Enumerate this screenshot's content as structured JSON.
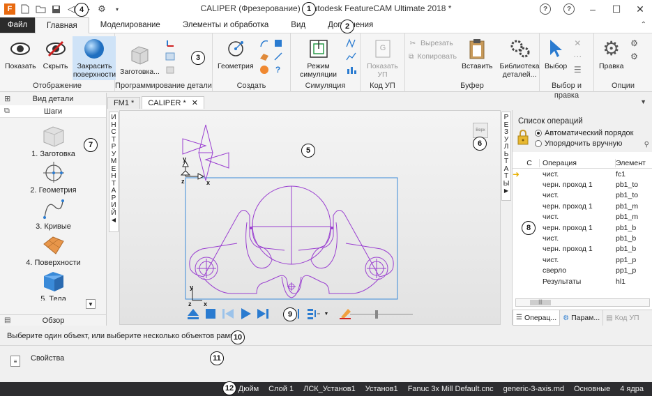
{
  "titlebar": {
    "title": "CALIPER (Фрезерование) - Autodesk FeatureCAM Ultimate 2018 *",
    "logo_text": "F"
  },
  "ribbon_tabs": [
    {
      "label": "Файл"
    },
    {
      "label": "Главная"
    },
    {
      "label": "Моделирование"
    },
    {
      "label": "Элементы и обработка"
    },
    {
      "label": "Вид"
    },
    {
      "label": "Дополнения"
    }
  ],
  "ribbon": {
    "groups": {
      "display": {
        "label": "Отображение",
        "show": "Показать",
        "hide": "Скрыть",
        "shade": "Закрасить поверхности"
      },
      "programming": {
        "label": "Программирование детали",
        "stock": "Заготовка..."
      },
      "create": {
        "label": "Создать",
        "geometry": "Геометрия"
      },
      "simulation": {
        "label": "Симуляция",
        "mode": "Режим симуляции"
      },
      "nc": {
        "label": "Код УП",
        "show_nc": "Показать УП",
        "nc_icon_letter": "G"
      },
      "clipboard": {
        "label": "Буфер",
        "cut": "Вырезать",
        "copy": "Копировать",
        "paste": "Вставить",
        "library": "Библиотека деталей..."
      },
      "select": {
        "label": "Выбор и правка",
        "select": "Выбор"
      },
      "options": {
        "label": "Опции",
        "edit": "Правка"
      }
    }
  },
  "left_panel": {
    "part_view": "Вид детали",
    "steps": "Шаги",
    "items": [
      {
        "label": "1.  Заготовка"
      },
      {
        "label": "2.  Геометрия"
      },
      {
        "label": "3.  Кривые"
      },
      {
        "label": "4.  Поверхности"
      },
      {
        "label": "5.  Тела"
      }
    ],
    "overview": "Обзор"
  },
  "doc_tabs": [
    {
      "label": "FM1 *"
    },
    {
      "label": "CALIPER *"
    }
  ],
  "side_tabs": {
    "tools": [
      "И",
      "Н",
      "С",
      "Т",
      "Р",
      "У",
      "М",
      "Е",
      "Н",
      "Т",
      "А",
      "Р",
      "И",
      "Й"
    ],
    "results": [
      "Р",
      "Е",
      "З",
      "У",
      "Л",
      "Ь",
      "Т",
      "А",
      "Т",
      "Ы"
    ]
  },
  "viewport": {
    "viewcube_label": "Верх",
    "axis_x": "x",
    "axis_y": "y",
    "axis_z": "z"
  },
  "right_panel": {
    "title": "Список операций",
    "auto_order": "Автоматический порядок",
    "manual_order": "Упорядочить вручную",
    "headers": {
      "c": "С",
      "operation": "Операция",
      "element": "Элемент"
    },
    "rows": [
      {
        "op": "чист.",
        "el": "fc1"
      },
      {
        "op": "черн. проход 1",
        "el": "pb1_to"
      },
      {
        "op": "чист.",
        "el": "pb1_to"
      },
      {
        "op": "черн. проход 1",
        "el": "pb1_m"
      },
      {
        "op": "чист.",
        "el": "pb1_m"
      },
      {
        "op": "черн. проход 1",
        "el": "pb1_b"
      },
      {
        "op": "чист.",
        "el": "pb1_b"
      },
      {
        "op": "черн. проход 1",
        "el": "pb1_b"
      },
      {
        "op": "чист.",
        "el": "pp1_p"
      },
      {
        "op": "сверло",
        "el": "pp1_p"
      },
      {
        "op": "Результаты",
        "el": "hl1"
      }
    ],
    "tabs": [
      {
        "label": "Операц..."
      },
      {
        "label": "Парам..."
      },
      {
        "label": "Код УП"
      }
    ]
  },
  "prompt": "Выберите один объект, или выберите несколько объектов рамкой",
  "properties": "Свойства",
  "statusbar": [
    "XY Дюйм",
    "Слой 1",
    "ЛСК_Установ1",
    "Установ1",
    "Fanuc 3x Mill Default.cnc",
    "generic-3-axis.md",
    "Основные",
    "4 ядра"
  ],
  "callouts": [
    "1",
    "2",
    "3",
    "4",
    "5",
    "6",
    "7",
    "8",
    "9",
    "10",
    "11",
    "12"
  ],
  "colors": {
    "accent_blue": "#2a7bd0",
    "sketch_purple": "#9a3fd0",
    "stock_blue": "#3a8ad8",
    "status_bg": "#2d2d30"
  }
}
